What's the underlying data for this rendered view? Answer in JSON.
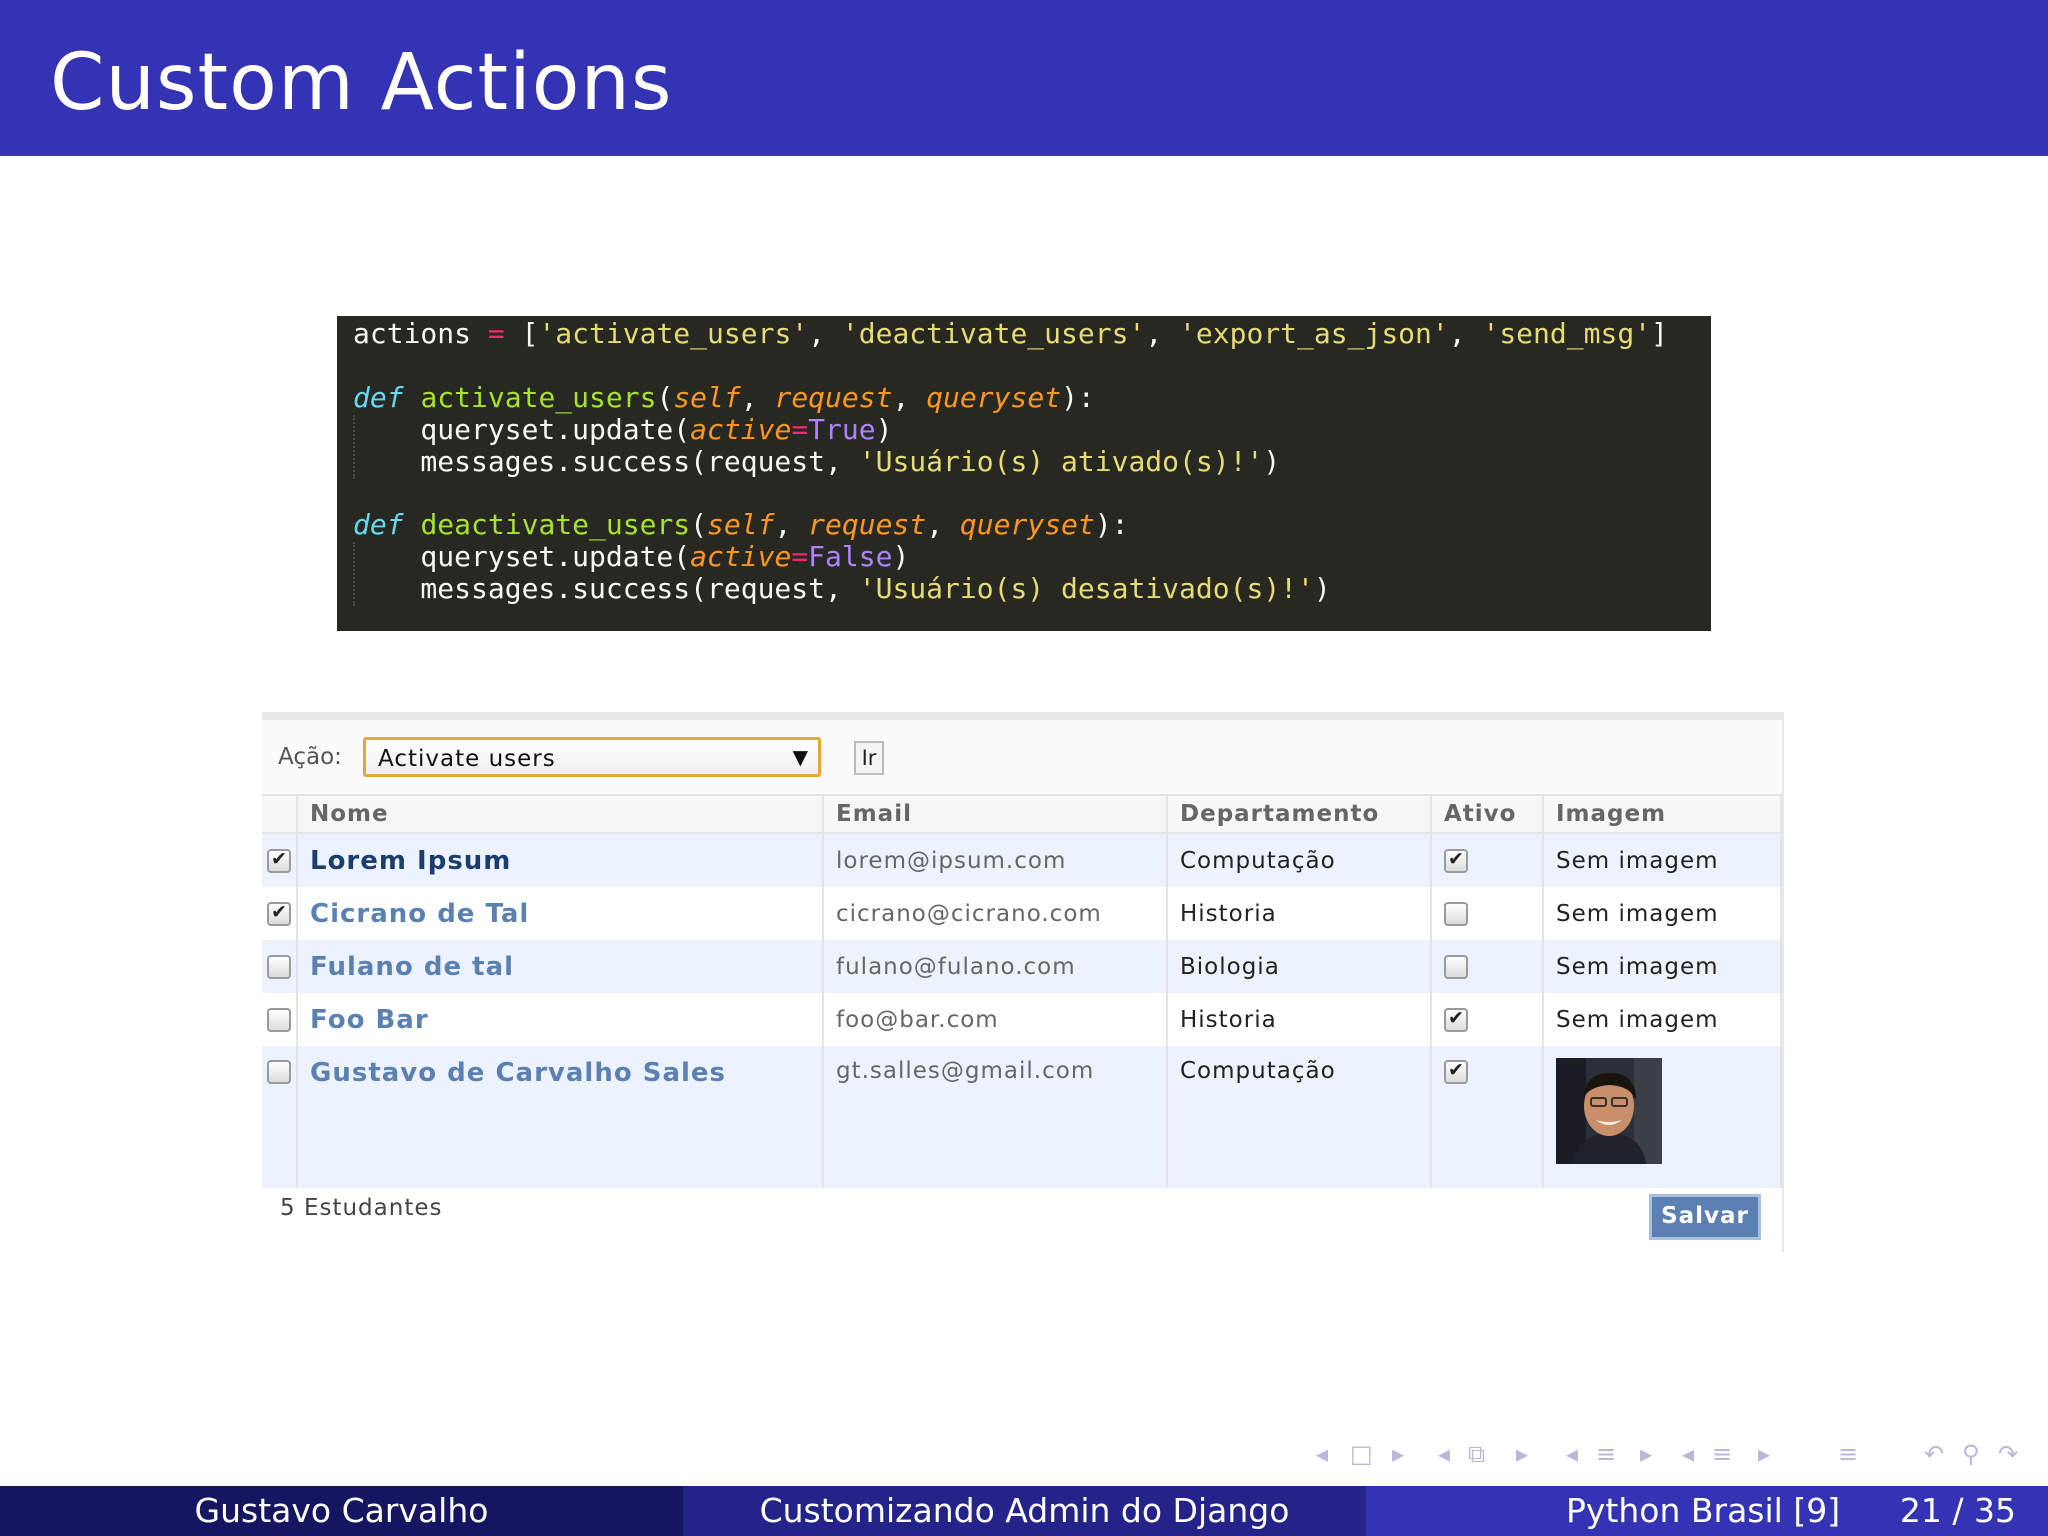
{
  "slide": {
    "title": "Custom Actions"
  },
  "code": {
    "line1": {
      "a": "actions ",
      "b": "=",
      "c": " [",
      "d": "'activate_users'",
      "e": ", ",
      "f": "'deactivate_users'",
      "g": ", ",
      "h": "'export_as_json'",
      "i": ", ",
      "j": "'send_msg'",
      "k": "]"
    },
    "func1": {
      "def": "def",
      "name": "activate_users",
      "self": "self",
      "request": "request",
      "queryset": "queryset",
      "update_prefix": "    queryset.update(",
      "kwarg": "active",
      "eq": "=",
      "value": "True",
      "msg_prefix": "    messages.success(request, ",
      "msg": "'Usuário(s) ativado(s)!'"
    },
    "func2": {
      "def": "def",
      "name": "deactivate_users",
      "self": "self",
      "request": "request",
      "queryset": "queryset",
      "update_prefix": "    queryset.update(",
      "kwarg": "active",
      "eq": "=",
      "value": "False",
      "msg_prefix": "    messages.success(request, ",
      "msg": "'Usuário(s) desativado(s)!'"
    }
  },
  "admin": {
    "action_label": "Ação:",
    "action_selected": "Activate users",
    "go_label": "Ir",
    "columns": [
      "Nome",
      "Email",
      "Departamento",
      "Ativo",
      "Imagem"
    ],
    "rows": [
      {
        "selected": true,
        "name": "Lorem Ipsum",
        "email": "lorem@ipsum.com",
        "dept": "Computação",
        "ativo": true,
        "imagem": "Sem imagem"
      },
      {
        "selected": true,
        "name": "Cicrano de Tal",
        "email": "cicrano@cicrano.com",
        "dept": "Historia",
        "ativo": false,
        "imagem": "Sem imagem"
      },
      {
        "selected": false,
        "name": "Fulano de tal",
        "email": "fulano@fulano.com",
        "dept": "Biologia",
        "ativo": false,
        "imagem": "Sem imagem"
      },
      {
        "selected": false,
        "name": "Foo Bar",
        "email": "foo@bar.com",
        "dept": "Historia",
        "ativo": true,
        "imagem": "Sem imagem"
      },
      {
        "selected": false,
        "name": "Gustavo de Carvalho Sales",
        "email": "gt.salles@gmail.com",
        "dept": "Computação",
        "ativo": true,
        "imagem": "photo"
      }
    ],
    "count_text": "5 Estudantes",
    "save_label": "Salvar"
  },
  "footer": {
    "author": "Gustavo Carvalho",
    "talk": "Customizando Admin do Django",
    "venue": "Python Brasil [9]",
    "page": "21 / 35"
  },
  "colors": {
    "title_bar": "#3333b3",
    "footer_dark": "#151561",
    "footer_mid": "#232389",
    "code_bg": "#272822",
    "admin_link": "#5b80b2"
  }
}
